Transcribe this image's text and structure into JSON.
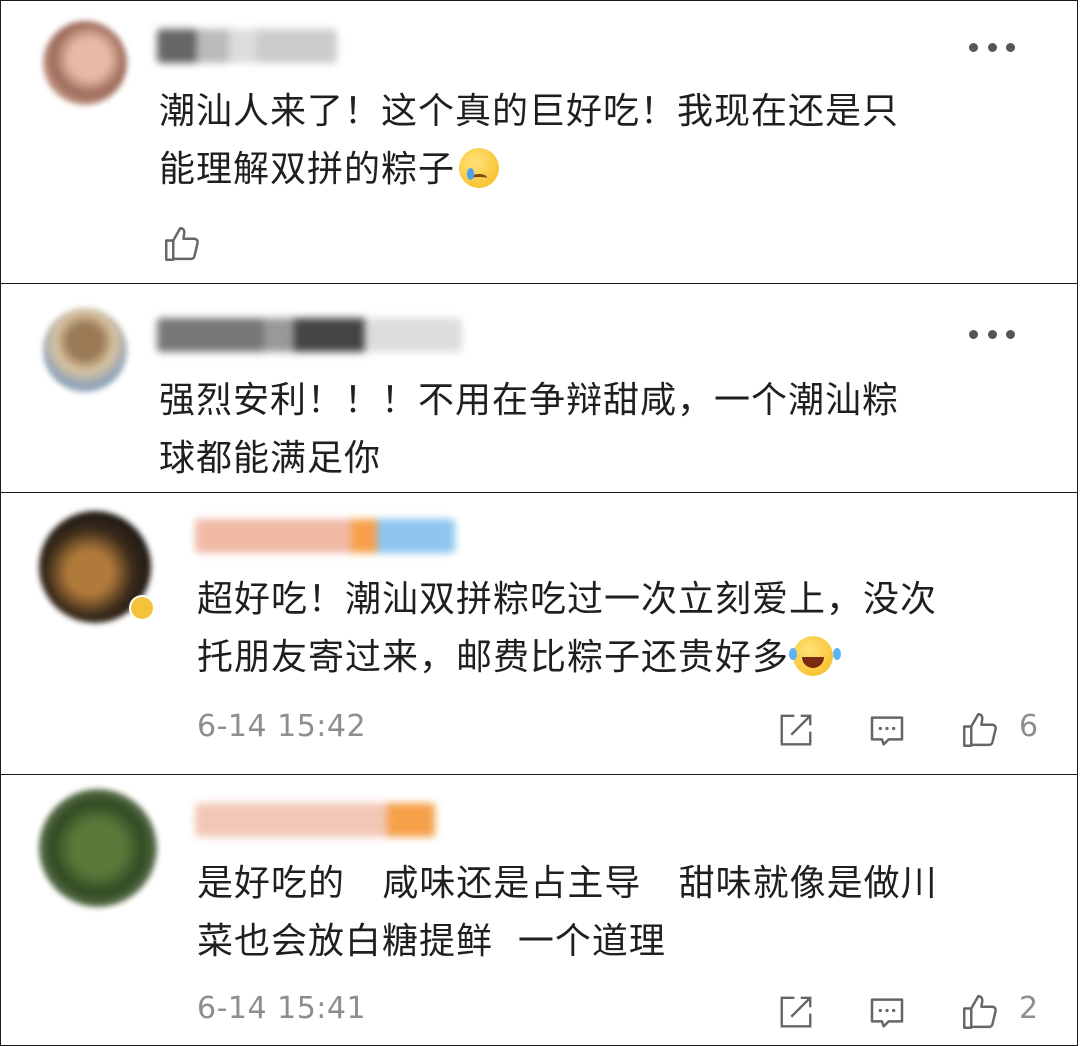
{
  "comments": [
    {
      "text_lines": [
        "潮汕人来了！这个真的巨好吃！我现在还是只",
        "能理解双拼的粽子"
      ],
      "emoji": "crying-face",
      "more_icon": "more-icon"
    },
    {
      "text_lines": [
        "强烈安利！！！不用在争辩甜咸，一个潮汕粽",
        "球都能满足你"
      ],
      "more_icon": "more-icon"
    },
    {
      "text_lines": [
        "超好吃！潮汕双拼粽吃过一次立刻爱上，没次",
        "托朋友寄过来，邮费比粽子还贵好多"
      ],
      "emoji": "laughing-crying-face",
      "time": "6-14 15:42",
      "likes": "6"
    },
    {
      "text_lines": [
        "是好吃的   咸味还是占主导   甜味就像是做川",
        "菜也会放白糖提鲜  一个道理"
      ],
      "time": "6-14 15:41",
      "likes": "2"
    }
  ],
  "colors": {
    "text": "#1f1f1f",
    "meta": "#8e8e8e",
    "border": "#1a1a1a",
    "badge": "#f5c33b"
  }
}
